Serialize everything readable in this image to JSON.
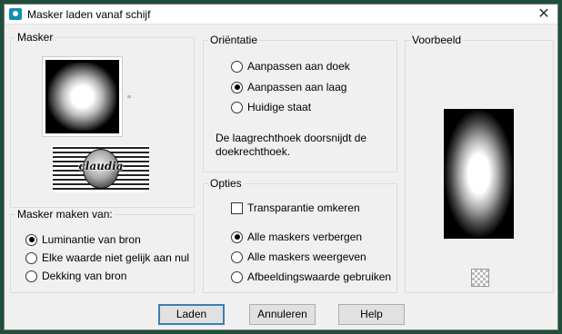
{
  "window": {
    "title": "Masker laden vanaf schijf",
    "close_glyph": "✕",
    "icon": "app-icon"
  },
  "masker": {
    "label": "Masker",
    "preview_icon": "radial-gradient-mask-thumbnail",
    "tube_icon": "claudia-watermark",
    "tube_text": "claudia"
  },
  "source": {
    "label": "Masker maken van:",
    "options": [
      {
        "label": "Luminantie van bron",
        "checked": true
      },
      {
        "label": "Elke waarde niet gelijk aan nul",
        "checked": false
      },
      {
        "label": "Dekking van bron",
        "checked": false
      }
    ]
  },
  "orientation": {
    "label": "Oriëntatie",
    "options": [
      {
        "label": "Aanpassen aan doek",
        "checked": false
      },
      {
        "label": "Aanpassen aan laag",
        "checked": true
      },
      {
        "label": "Huidige staat",
        "checked": false
      }
    ],
    "description": "De laagrechthoek doorsnijdt de doekrechthoek."
  },
  "options": {
    "label": "Opties",
    "invert": {
      "label": "Transparantie omkeren",
      "checked": false
    },
    "masks": [
      {
        "label": "Alle maskers verbergen",
        "checked": true
      },
      {
        "label": "Alle maskers weergeven",
        "checked": false
      },
      {
        "label": "Afbeeldingswaarde gebruiken",
        "checked": false
      }
    ]
  },
  "preview": {
    "label": "Voorbeeld",
    "checker_icon": "transparency-checker-icon"
  },
  "buttons": {
    "load": "Laden",
    "cancel": "Annuleren",
    "help": "Help"
  },
  "colors": {
    "frame": "#1f4f3a",
    "dialog_bg": "#f0f0f0",
    "default_button_border": "#3c7fb1",
    "title_icon": "#0e8fb3"
  }
}
